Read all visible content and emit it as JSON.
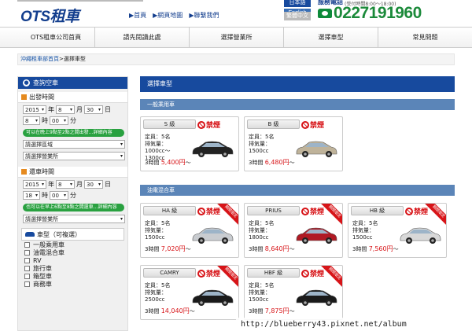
{
  "header": {
    "logo": "OTS租車",
    "links": [
      "▶首頁",
      "▶網頁地圖",
      "▶聯繫我們"
    ],
    "lang": [
      "日本語",
      "English",
      "繁體中文",
      "한국어"
    ],
    "phone_label": "服務電話",
    "phone_hours": "(受付時間8:00～18:00)",
    "phone_number": "0227191960"
  },
  "nav": [
    "OTS租車公司首頁",
    "請先閱讀此處",
    "選擇營業所",
    "選擇車型",
    "常見問題"
  ],
  "breadcrumb": {
    "link": "沖繩租車部首頁",
    "current": "選擇車型"
  },
  "sidebar": {
    "title": "查詢空車",
    "depart": {
      "label": "出發時間",
      "year": "2015",
      "year_unit": "年",
      "month": "8",
      "month_unit": "月",
      "day": "30",
      "day_unit": "日",
      "hour": "8",
      "hour_unit": "時",
      "minute": "00",
      "minute_unit": "分",
      "note": "可以在晚上9點至2點之間出發…詳細內容",
      "area_placeholder": "請選擇區域",
      "office_placeholder": "請選擇營業所"
    },
    "return": {
      "label": "還車時間",
      "year": "2015",
      "year_unit": "年",
      "month": "8",
      "month_unit": "月",
      "day": "30",
      "day_unit": "日",
      "hour": "18",
      "hour_unit": "時",
      "minute": "00",
      "minute_unit": "分",
      "note": "也可以在早上6點至8點之間還車…詳細內容",
      "office_placeholder": "請選擇營業所"
    },
    "cartype": {
      "label": "車型（可複選）",
      "options": [
        "一般乘用車",
        "油電混合車",
        "RV",
        "旅行車",
        "箱型車",
        "商務車"
      ]
    }
  },
  "main": {
    "title": "選擇車型",
    "groups": [
      {
        "label": "一般乘用車"
      },
      {
        "label": "油電混合車"
      }
    ],
    "cards": [
      {
        "class": "S 級",
        "no_smoking": "禁煙",
        "seats": "定員：5名",
        "disp": "排気量：1000cc～1300cc",
        "price_prefix": "3時間",
        "price": "5,400円",
        "price_suffix": "～",
        "ribbon": "",
        "car_color": "#222"
      },
      {
        "class": "B 級",
        "no_smoking": "禁煙",
        "seats": "定員：5名",
        "disp": "排気量：1500cc",
        "price_prefix": "3時間",
        "price": "6,480円",
        "price_suffix": "～",
        "ribbon": "",
        "car_color": "#bfb39a"
      },
      {
        "class": "HA 級",
        "no_smoking": "禁煙",
        "seats": "定員：5名",
        "disp": "排気量：1500cc",
        "price_prefix": "3時間",
        "price": "7,020円",
        "price_suffix": "～",
        "ribbon": "期間限定",
        "car_color": "#c9ccd0"
      },
      {
        "class": "PRIUS",
        "no_smoking": "禁煙",
        "seats": "定員：5名",
        "disp": "排気量：1800cc",
        "price_prefix": "3時間",
        "price": "8,640円",
        "price_suffix": "～",
        "ribbon": "期間限定",
        "car_color": "#b01a24"
      },
      {
        "class": "HB 級",
        "no_smoking": "禁煙",
        "seats": "定員：5名",
        "disp": "排気量：1500cc",
        "price_prefix": "3時間",
        "price": "7,560円",
        "price_suffix": "～",
        "ribbon": "期間限定",
        "car_color": "#d8d8d8"
      },
      {
        "class": "CAMRY",
        "no_smoking": "禁煙",
        "seats": "定員：5名",
        "disp": "排気量：2500cc",
        "price_prefix": "3時間",
        "price": "14,040円",
        "price_suffix": "～",
        "ribbon": "期間限定",
        "car_color": "#1a1a1a"
      },
      {
        "class": "HBF 級",
        "no_smoking": "禁煙",
        "seats": "定員：5名",
        "disp": "排気量：1500cc",
        "price_prefix": "3時間",
        "price": "7,875円",
        "price_suffix": "～",
        "ribbon": "期間限定",
        "car_color": "#1a1a1a"
      }
    ]
  },
  "watermark": "http://blueberry43.pixnet.net/album"
}
